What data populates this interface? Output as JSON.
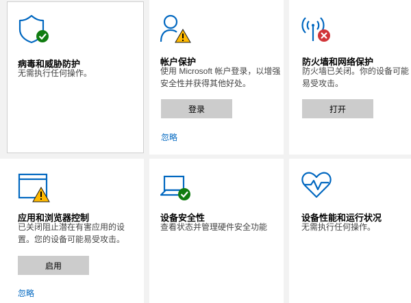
{
  "tiles": [
    {
      "title": "病毒和威胁防护",
      "description": "无需执行任何操作。",
      "icon": "shield-check-icon",
      "status": "ok"
    },
    {
      "title": "帐户保护",
      "description": "使用 Microsoft 帐户登录，以增强安全性并获得其他好处。",
      "icon": "person-warning-icon",
      "status": "warning",
      "button_label": "登录",
      "link_label": "忽略"
    },
    {
      "title": "防火墙和网络保护",
      "description": "防火墙已关闭。你的设备可能易受攻击。",
      "icon": "antenna-error-icon",
      "status": "error",
      "button_label": "打开"
    },
    {
      "title": "应用和浏览器控制",
      "description": "已关闭阻止潜在有害应用的设置。您的设备可能易受攻击。",
      "icon": "browser-warning-icon",
      "status": "warning",
      "button_label": "启用",
      "link_label": "忽略"
    },
    {
      "title": "设备安全性",
      "description": "查看状态并管理硬件安全功能",
      "icon": "laptop-check-icon",
      "status": "ok"
    },
    {
      "title": "设备性能和运行状况",
      "description": "无需执行任何操作。",
      "icon": "heart-pulse-icon",
      "status": "ok"
    }
  ],
  "colors": {
    "accent": "#0067c0",
    "ok": "#107c10",
    "warning": "#ffb900",
    "error": "#d13438"
  }
}
